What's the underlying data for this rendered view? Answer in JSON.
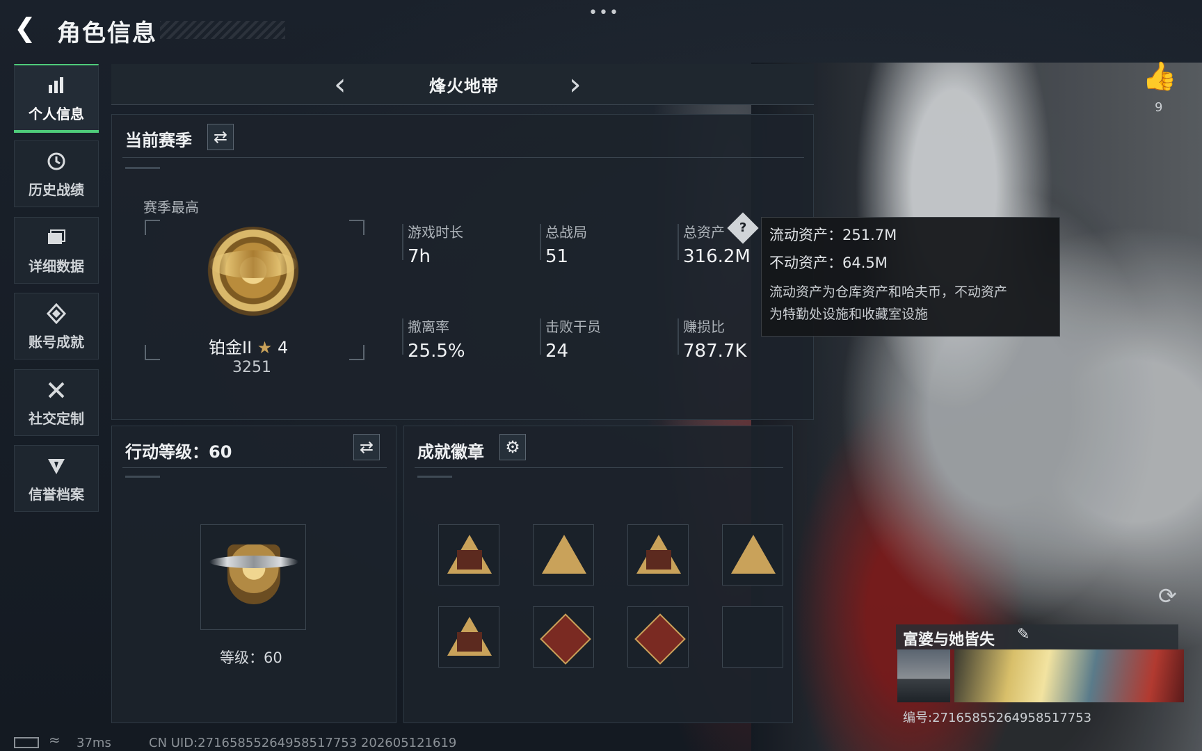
{
  "header": {
    "back_icon": "back-arrow-icon",
    "title": "角色信息",
    "menu_icon": "more-dots-icon"
  },
  "sidebar": {
    "items": [
      {
        "label": "个人信息",
        "icon": "bar-chart-icon",
        "active": true
      },
      {
        "label": "历史战绩",
        "icon": "history-icon"
      },
      {
        "label": "详细数据",
        "icon": "folder-icon"
      },
      {
        "label": "账号成就",
        "icon": "achievement-icon"
      },
      {
        "label": "社交定制",
        "icon": "tools-icon"
      },
      {
        "label": "信誉档案",
        "icon": "shield-rank-icon"
      }
    ]
  },
  "mode": {
    "name": "烽火地带"
  },
  "season": {
    "title": "当前赛季",
    "best_label": "赛季最高",
    "rank_name": "铂金II",
    "rank_stars": "4",
    "rank_points": "3251",
    "stats": [
      {
        "label": "游戏时长",
        "value": "7h"
      },
      {
        "label": "总战局",
        "value": "51"
      },
      {
        "label": "总资产",
        "value": "316.2M"
      },
      {
        "label": "撤离率",
        "value": "25.5%"
      },
      {
        "label": "击败干员",
        "value": "24"
      },
      {
        "label": "赚损比",
        "value": "787.7K"
      }
    ]
  },
  "tooltip": {
    "liquid": "流动资产：251.7M",
    "fixed": "不动资产：64.5M",
    "desc_line1": "流动资产为仓库资产和哈夫币，不动资产",
    "desc_line2": "为特勤处设施和收藏室设施"
  },
  "level": {
    "title": "行动等级：60",
    "caption": "等级：60"
  },
  "badges": {
    "title": "成就徽章"
  },
  "profile": {
    "like_count": "9",
    "nickname": "富婆与她皆失",
    "uid_right": "编号:27165855264958517753"
  },
  "statusbar": {
    "ping": "37ms",
    "uid": "CN UID:27165855264958517753 202605121619"
  },
  "colors": {
    "accent": "#4ecb7a",
    "panel": "#1c232b",
    "gold": "#c9a25a"
  }
}
